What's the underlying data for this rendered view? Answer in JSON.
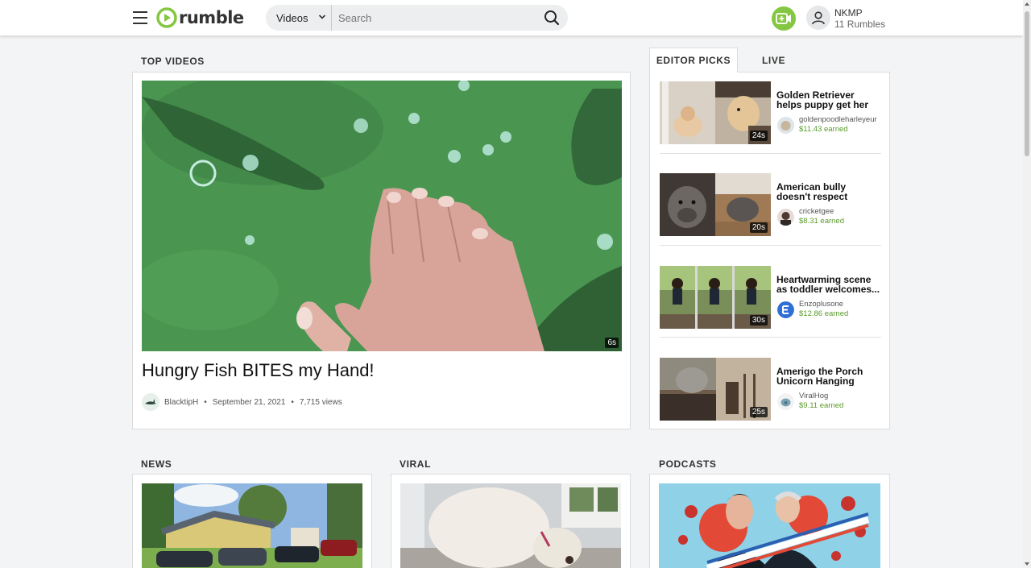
{
  "header": {
    "logo_text": "rumble",
    "search_category": "Videos",
    "search_placeholder": "Search",
    "user_name": "NKMP",
    "user_rumbles": "11 Rumbles",
    "brand_color": "#85c742"
  },
  "top_videos": {
    "section_title": "TOP VIDEOS",
    "title": "Hungry Fish BITES my Hand!",
    "duration": "6s",
    "channel": "BlacktipH",
    "date": "September 21, 2021",
    "views": "7,715 views",
    "separator": "•"
  },
  "editor_picks": {
    "tab_editor": "EDITOR PICKS",
    "tab_live": "LIVE",
    "items": [
      {
        "title": "Golden Retriever helps puppy get her favorite to",
        "channel": "goldenpoodleharleyeur",
        "earned": "$11.43 earned",
        "duration": "24s"
      },
      {
        "title": "American bully doesn't respect personal space",
        "channel": "cricketgee",
        "earned": "$8.31 earned",
        "duration": "20s"
      },
      {
        "title": "Heartwarming scene as toddler welcomes...",
        "channel": "Enzoplusone",
        "earned": "$12.86 earned",
        "duration": "30s"
      },
      {
        "title": "Amerigo the Porch Unicorn Hanging Out...",
        "channel": "ViralHog",
        "earned": "$9.11 earned",
        "duration": "25s"
      }
    ]
  },
  "sections": {
    "news": "NEWS",
    "viral": "VIRAL",
    "podcasts": "PODCASTS"
  }
}
